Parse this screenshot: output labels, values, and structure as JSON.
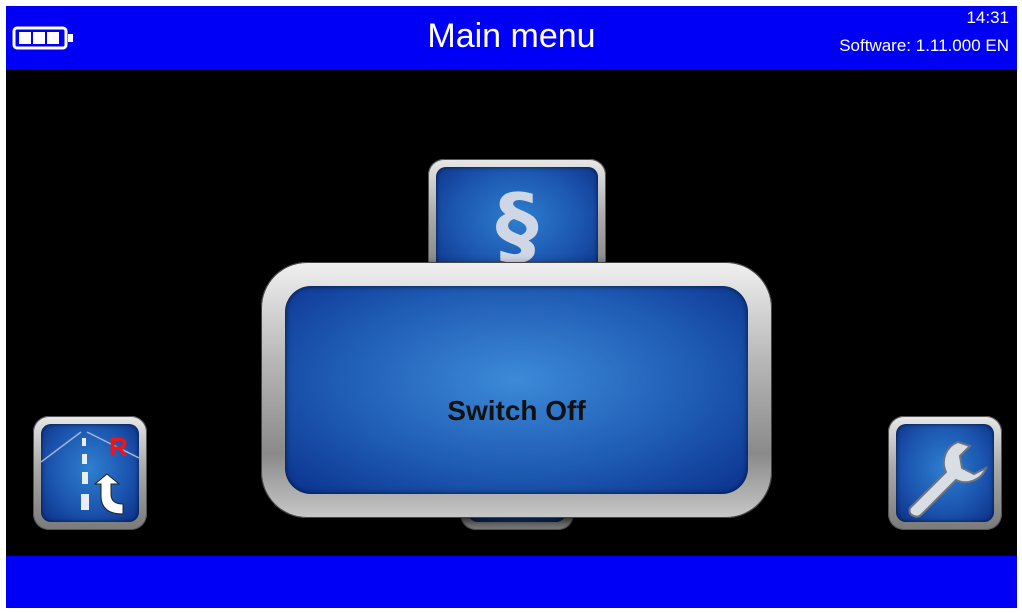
{
  "header": {
    "title": "Main menu",
    "time": "14:31",
    "software": "Software: 1.11.000 EN",
    "battery_icon": "battery-icon"
  },
  "menu": {
    "top_tile_icon": "paragraph-icon",
    "top_tile_glyph": "§",
    "left_tile_icon": "road-reverse-icon",
    "left_tile_letter": "R",
    "right_tile_icon": "wrench-icon",
    "bottom_tile_icon": "menu-tile"
  },
  "dialog": {
    "label": "Switch Off"
  },
  "colors": {
    "bar": "#0000f6",
    "background": "#000000",
    "tile_blue": "#1c56b0",
    "accent_red": "#ff1010"
  }
}
